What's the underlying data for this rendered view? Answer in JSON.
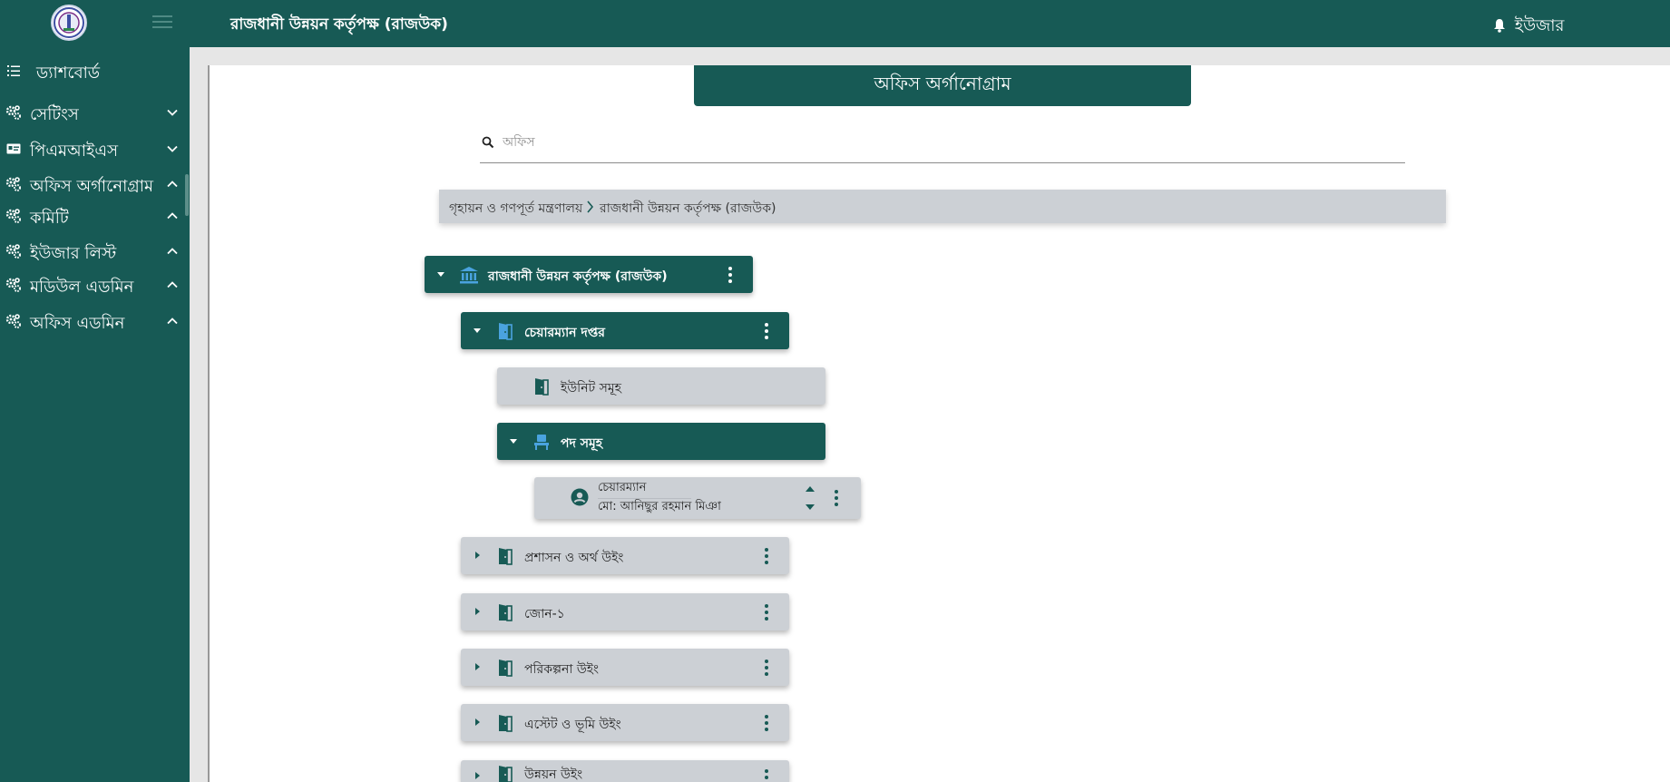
{
  "header": {
    "title": "রাজধানী উন্নয়ন কর্তৃপক্ষ (রাজউক)",
    "user_label": "ইউজার",
    "logo_icon": "rajuk-logo",
    "menu_icon": "hamburger-icon",
    "notification_icon": "bell-icon"
  },
  "sidebar": {
    "items": [
      {
        "label": "ড্যাশবোর্ড",
        "icon": "list-icon",
        "chevron": "none"
      },
      {
        "label": "সেটিংস",
        "icon": "gears-icon",
        "chevron": "down"
      },
      {
        "label": "পিএমআইএস",
        "icon": "id-card-icon",
        "chevron": "down"
      },
      {
        "label": "অফিস অর্গানোগ্রাম",
        "icon": "gears-icon",
        "chevron": "up"
      },
      {
        "label": "কমিটি",
        "icon": "gears-icon",
        "chevron": "up"
      },
      {
        "label": "ইউজার লিস্ট",
        "icon": "gears-icon",
        "chevron": "up"
      },
      {
        "label": "মডিউল এডমিন",
        "icon": "gears-icon",
        "chevron": "up"
      },
      {
        "label": "অফিস এডমিন",
        "icon": "gears-icon",
        "chevron": "up"
      }
    ]
  },
  "main": {
    "title": "অফিস অর্গানোগ্রাম",
    "search": {
      "placeholder": "অফিস",
      "value": ""
    },
    "breadcrumb": [
      "গৃহায়ন ও গণপূর্ত মন্ত্রণালয়",
      "রাজধানী উন্নয়ন কর্তৃপক্ষ (রাজউক)"
    ],
    "tree": {
      "root": {
        "label": "রাজধানী উন্নয়ন কর্তৃপক্ষ (রাজউক)",
        "icon": "institution-icon",
        "expanded": true
      },
      "chairman_office": {
        "label": "চেয়ারম্যান দপ্তর",
        "icon": "door-icon",
        "expanded": true
      },
      "units": {
        "label": "ইউনিট সমূহ",
        "icon": "door-icon"
      },
      "posts": {
        "label": "পদ সমূহ",
        "icon": "desk-chair-icon",
        "expanded": true
      },
      "person": {
        "role": "চেয়ারম্যান",
        "name": "মো: আনিছুর রহমান মিঞা",
        "icon": "user-circle-icon"
      },
      "wings": [
        {
          "label": "প্রশাসন ও অর্থ উইং",
          "icon": "door-icon",
          "expanded": false
        },
        {
          "label": "জোন-১",
          "icon": "door-icon",
          "expanded": false
        },
        {
          "label": "পরিকল্পনা উইং",
          "icon": "door-icon",
          "expanded": false
        },
        {
          "label": "এস্টেট ও ভূমি উইং",
          "icon": "door-icon",
          "expanded": false
        },
        {
          "label": "উন্নয়ন উইং",
          "icon": "door-icon",
          "expanded": false
        }
      ]
    }
  },
  "colors": {
    "primary": "#175a55",
    "card_light": "#ccd0d5",
    "icon_accent": "#4aa3df",
    "background": "#e6e6e6"
  }
}
